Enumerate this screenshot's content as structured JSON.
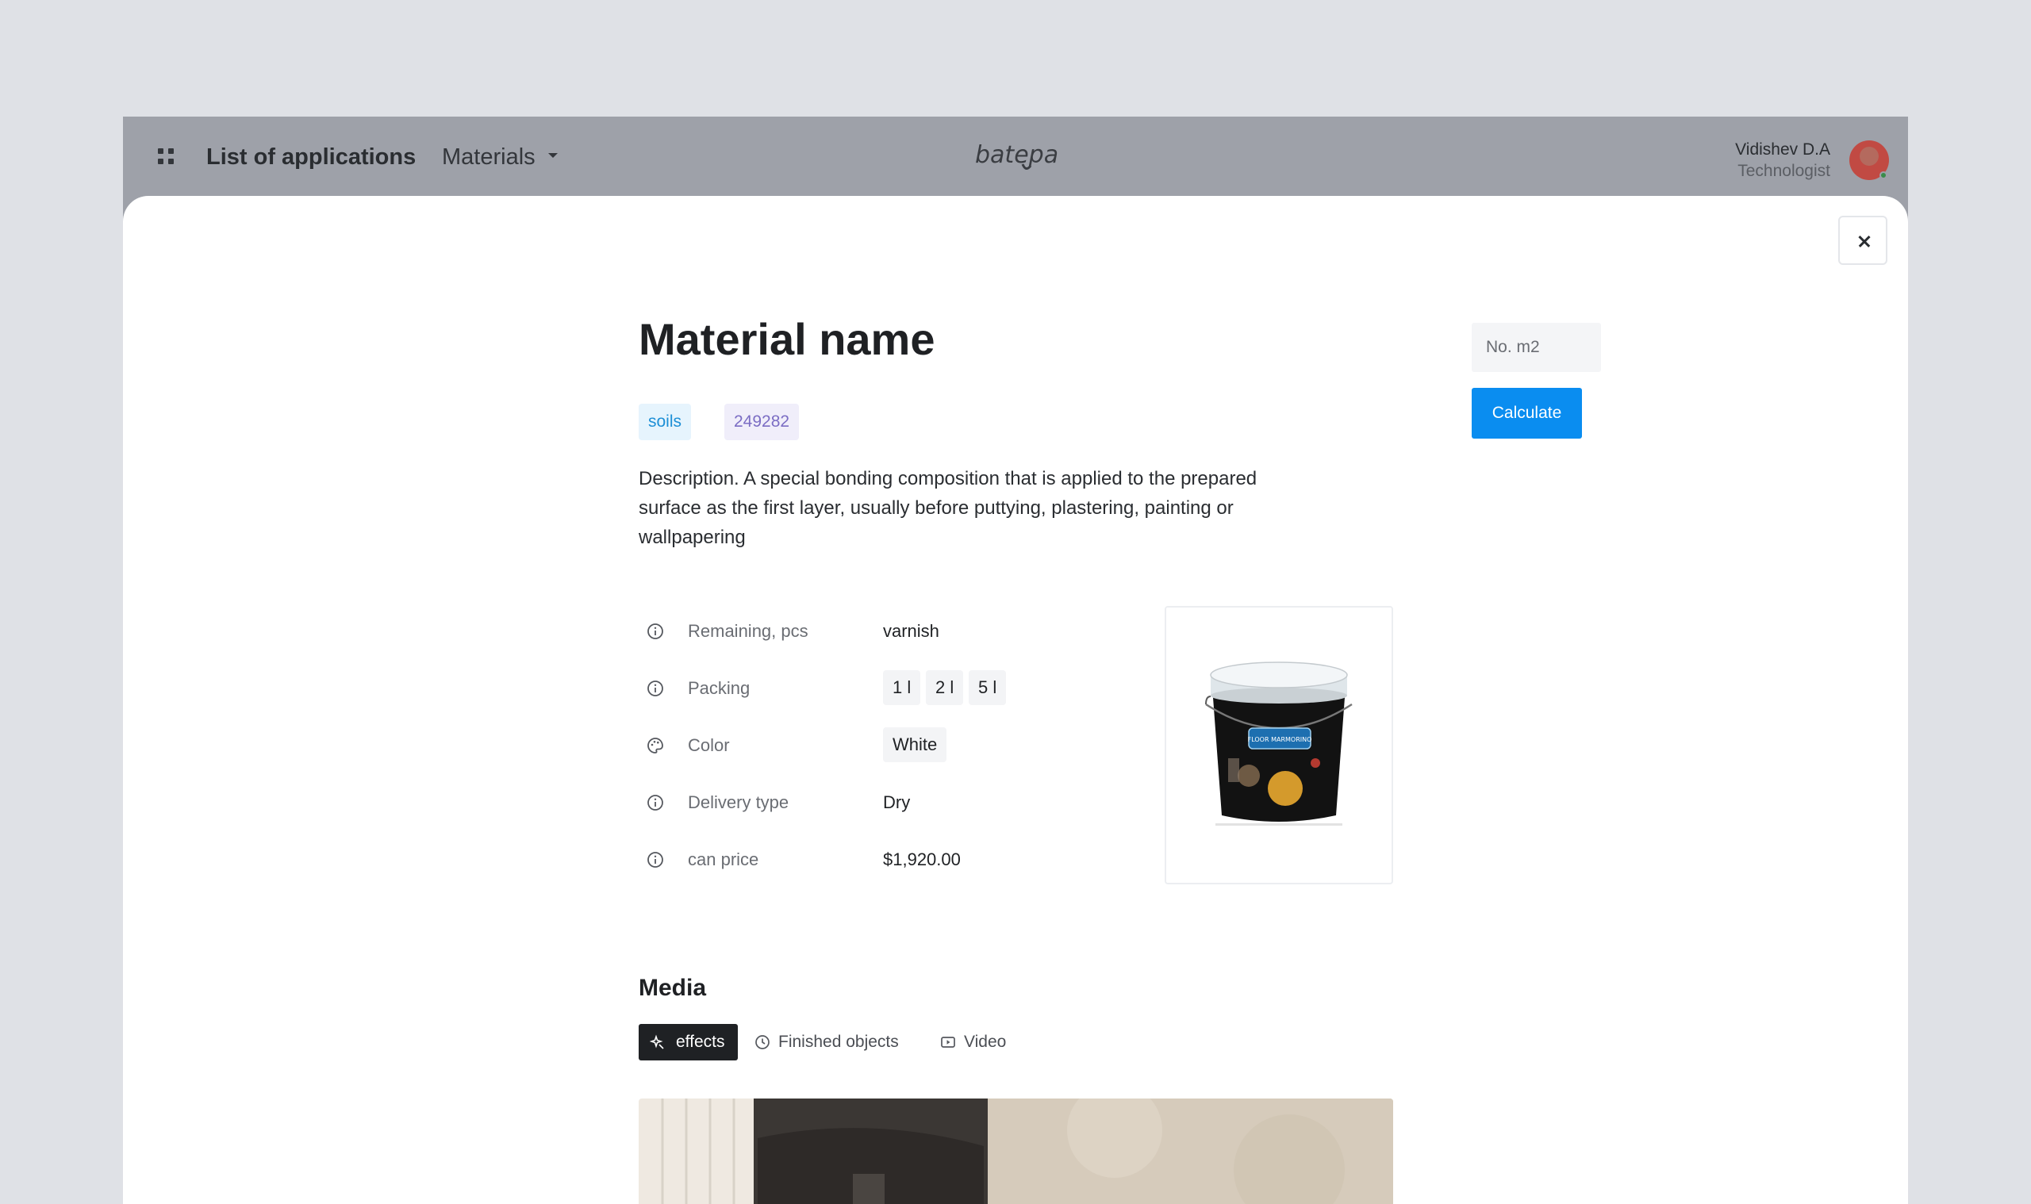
{
  "header": {
    "nav_title": "List of applications",
    "materials_menu": "Materials",
    "logo_text": "batepa",
    "user_name": "Vidishev D.A",
    "user_role": "Technologist"
  },
  "material": {
    "name": "Material name",
    "tags": [
      "soils",
      "249282"
    ],
    "description": "Description. A special bonding composition that is applied to the prepared surface as the first layer, usually before puttying, plastering, painting or wallpapering",
    "properties": {
      "remaining": {
        "label": "Remaining, pcs",
        "value": "varnish"
      },
      "packing": {
        "label": "Packing",
        "options": [
          "1 l",
          "2 l",
          "5 l"
        ]
      },
      "color": {
        "label": "Color",
        "value": "White"
      },
      "delivery": {
        "label": "Delivery type",
        "value": "Dry"
      },
      "price": {
        "label": "can price",
        "value": "$1,920.00"
      }
    },
    "product_label": "FLOOR MARMORINO"
  },
  "calculator": {
    "placeholder": "No. m2",
    "button": "Calculate"
  },
  "media": {
    "title": "Media",
    "tabs": [
      "effects",
      "Finished objects",
      "Video"
    ]
  },
  "colors": {
    "accent": "#0a8df0",
    "tag_blue_bg": "#e6f4fd",
    "tag_blue_text": "#1d8fd6",
    "tag_purple_bg": "#f0eefa",
    "tag_purple_text": "#7b6dc4",
    "dark_tab": "#1f2124"
  }
}
